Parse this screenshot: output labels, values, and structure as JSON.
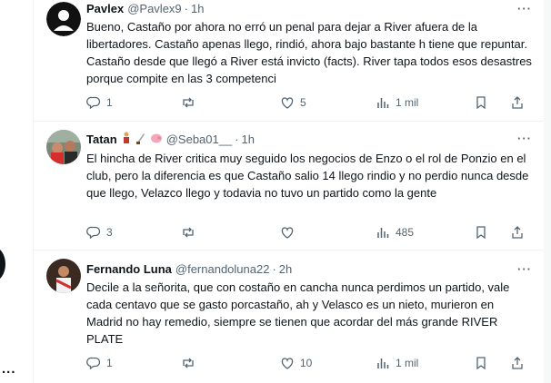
{
  "tweets": [
    {
      "name": "Pavlex",
      "handle": "@Pavlex9",
      "time": "1h",
      "text": "Bueno, Castaño por ahora no erró un penal para dejar a River afuera de la libertadores. Castaño apenas llego, rindió, ahora bajo bastante h tiene que repuntar. Castaño desde que llegó a River está invicto (facts). River tapa todos esos desastres porque compite en las 3 competenci",
      "replies": "1",
      "retweets": "",
      "likes": "5",
      "views": "1 mil"
    },
    {
      "name": "Tatan",
      "handle": "@Seba01__",
      "time": "1h",
      "text": "El hincha de River critica muy seguido los negocios de Enzo o el rol de Ponzio en el club, pero la diferencia es que Castaño salio 14 llego rindio y no perdio nunca desde que llego, Velazco llego y todavia no tuvo un partido como la gente",
      "replies": "3",
      "retweets": "",
      "likes": "",
      "views": "485",
      "emoji_icons": [
        "figure-icon",
        "knife-icon",
        "pig-icon"
      ]
    },
    {
      "name": "Fernando Luna",
      "handle": "@fernandoluna22",
      "time": "2h",
      "text": "Decile a la señorita, que con costaño en cancha nunca perdimos un partido, vale cada centavo que se gasto porcastaño, ah y Velasco es un nieto, murieron en Madrid no hay remedio, siempre se tienen que acordar del más grande RIVER PLATE",
      "replies": "1",
      "retweets": "",
      "likes": "10",
      "views": "1 mil"
    }
  ],
  "left": {
    "more_label": "..."
  },
  "colors": {
    "text": "#0f1419",
    "muted": "#536471",
    "border": "#eff3f4"
  }
}
